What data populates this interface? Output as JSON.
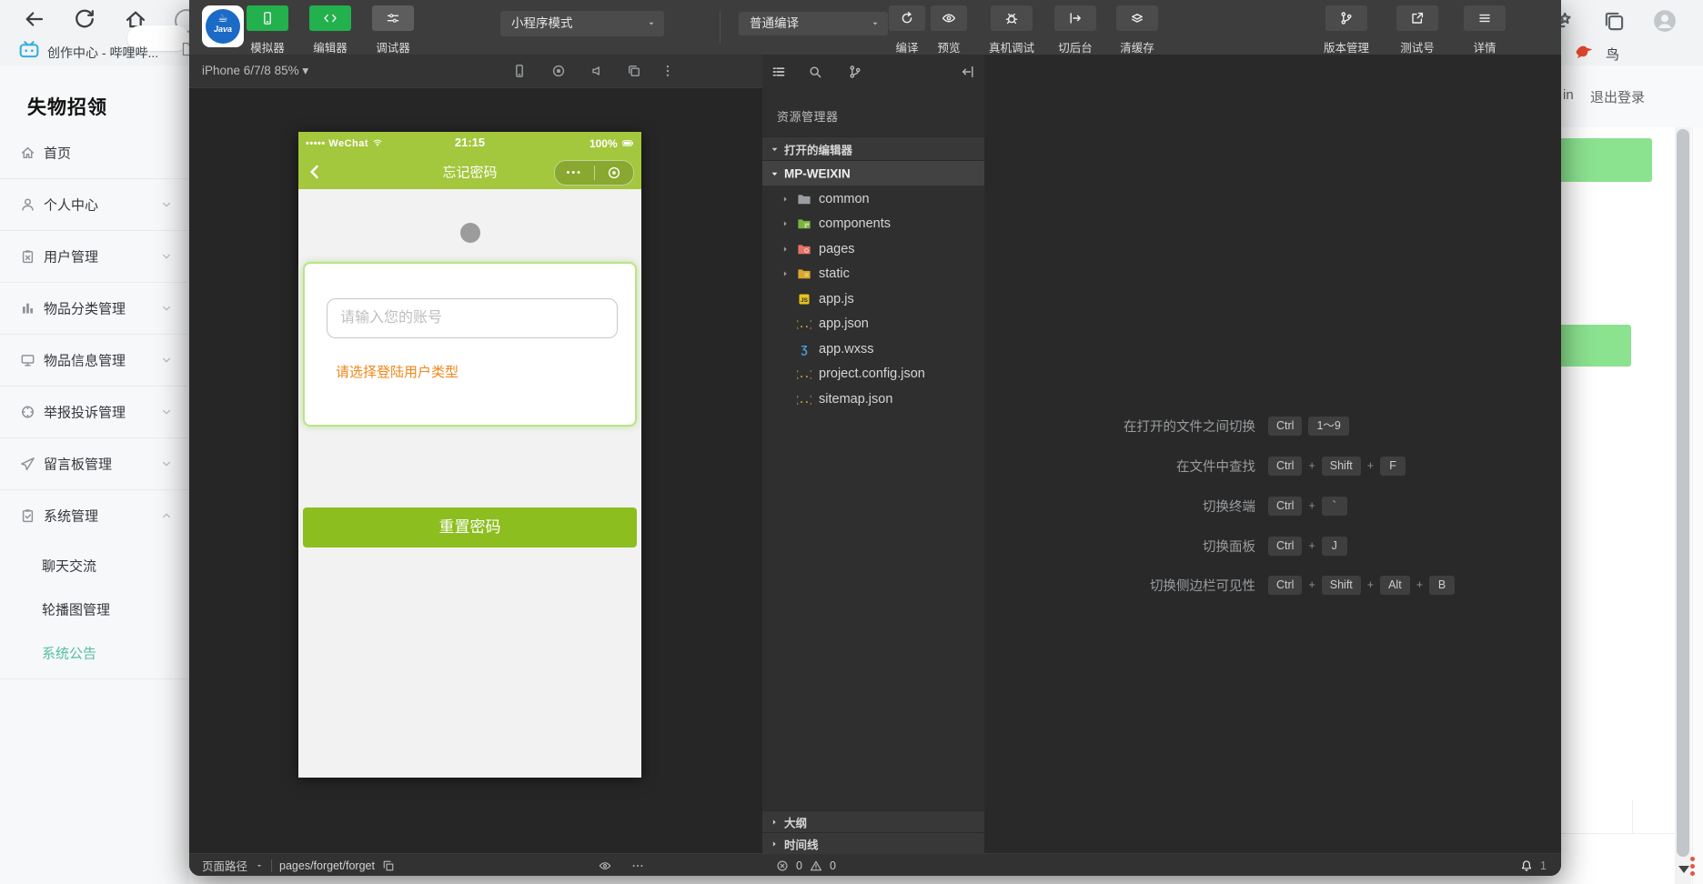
{
  "browser": {
    "tab": {
      "title": "创作中心 - 哔哩哔...",
      "favicon": "bilibili-tv"
    },
    "bookmark_bird": "鸟"
  },
  "admin": {
    "title": "失物招领",
    "menu": [
      {
        "label": "首页",
        "icon": "home",
        "chevron": "none"
      },
      {
        "label": "个人中心",
        "icon": "user",
        "chevron": "down"
      },
      {
        "label": "用户管理",
        "icon": "clipboard-x",
        "chevron": "down"
      },
      {
        "label": "物品分类管理",
        "icon": "bars",
        "chevron": "down"
      },
      {
        "label": "物品信息管理",
        "icon": "monitor",
        "chevron": "down"
      },
      {
        "label": "举报投诉管理",
        "icon": "crosshair",
        "chevron": "down"
      },
      {
        "label": "留言板管理",
        "icon": "send",
        "chevron": "down"
      },
      {
        "label": "系统管理",
        "icon": "clipboard-check",
        "chevron": "up"
      }
    ],
    "submenu": [
      {
        "label": "聊天交流",
        "active": false
      },
      {
        "label": "轮播图管理",
        "active": false
      },
      {
        "label": "系统公告",
        "active": true
      }
    ],
    "header": {
      "user_fragment": "in",
      "logout": "退出登录"
    },
    "accent_color": "#53c0a2"
  },
  "devtools": {
    "logo_text": "Java",
    "main_tabs": [
      {
        "label": "模拟器",
        "icon": "phone-dev",
        "active": true
      },
      {
        "label": "编辑器",
        "icon": "code",
        "active": true
      },
      {
        "label": "调试器",
        "icon": "sliders",
        "active": false
      }
    ],
    "mode_dropdown": "小程序模式",
    "compile_dropdown": "普通编译",
    "compile_actions": [
      {
        "label": "编译",
        "icon": "refresh"
      },
      {
        "label": "预览",
        "icon": "eye"
      }
    ],
    "device_actions": [
      {
        "label": "真机调试",
        "icon": "bug"
      },
      {
        "label": "切后台",
        "icon": "background"
      },
      {
        "label": "清缓存",
        "icon": "cache"
      }
    ],
    "right_actions": [
      {
        "label": "版本管理",
        "icon": "branch"
      },
      {
        "label": "测试号",
        "icon": "external"
      },
      {
        "label": "详情",
        "icon": "menu-b"
      }
    ],
    "simulator": {
      "device_label": "iPhone 6/7/8 85%",
      "phone": {
        "carrier": "••••• WeChat",
        "time": "21:15",
        "battery": "100%",
        "title": "忘记密码",
        "capsule_dots": "•••",
        "input_placeholder": "请输入您的账号",
        "warning": "请选择登陆用户类型",
        "submit": "重置密码"
      }
    },
    "explorer": {
      "title": "资源管理器",
      "sections": [
        {
          "label": "打开的编辑器"
        },
        {
          "label": "MP-WEIXIN"
        }
      ],
      "tree": [
        {
          "name": "common",
          "icon": "folder-gray",
          "folder": true
        },
        {
          "name": "components",
          "icon": "folder-green",
          "folder": true
        },
        {
          "name": "pages",
          "icon": "folder-red",
          "folder": true
        },
        {
          "name": "static",
          "icon": "folder-yellow",
          "folder": true
        },
        {
          "name": "app.js",
          "icon": "file-js",
          "folder": false
        },
        {
          "name": "app.json",
          "icon": "file-json",
          "folder": false
        },
        {
          "name": "app.wxss",
          "icon": "file-wxss",
          "folder": false
        },
        {
          "name": "project.config.json",
          "icon": "file-json",
          "folder": false
        },
        {
          "name": "sitemap.json",
          "icon": "file-json",
          "folder": false
        }
      ],
      "bottom_sections": [
        "大纲",
        "时间线"
      ]
    },
    "shortcuts": [
      {
        "label": "在打开的文件之间切换",
        "keys": [
          "Ctrl",
          "1～9"
        ],
        "plus": false
      },
      {
        "label": "在文件中查找",
        "keys": [
          "Ctrl",
          "Shift",
          "F"
        ],
        "plus": true
      },
      {
        "label": "切换终端",
        "keys": [
          "Ctrl",
          "`"
        ],
        "plus": true
      },
      {
        "label": "切换面板",
        "keys": [
          "Ctrl",
          "J"
        ],
        "plus": true
      },
      {
        "label": "切换侧边栏可见性",
        "keys": [
          "Ctrl",
          "Shift",
          "Alt",
          "B"
        ],
        "plus": true
      }
    ],
    "statusbar": {
      "path_label": "页面路径",
      "path": "pages/forget/forget",
      "errors": "0",
      "warnings": "0",
      "bell_count": "1"
    }
  }
}
